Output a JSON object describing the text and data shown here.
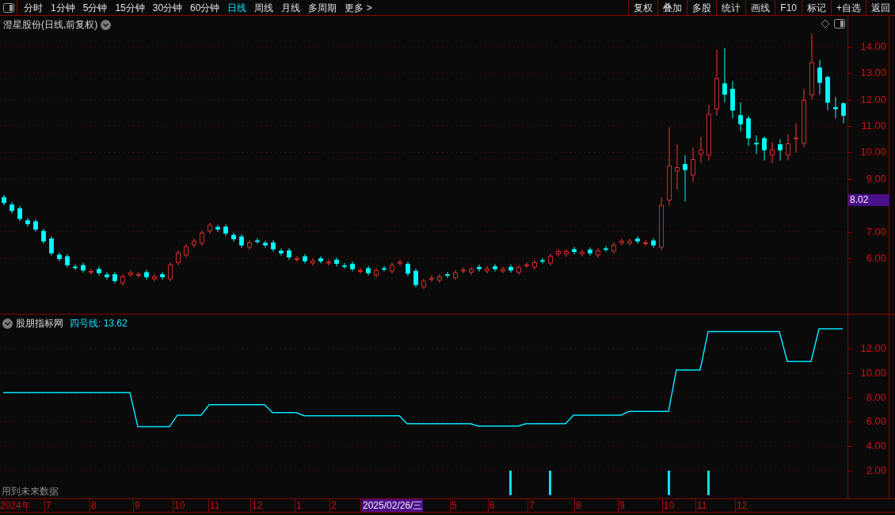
{
  "toolbar": {
    "periods": [
      {
        "label": "分时",
        "selected": false
      },
      {
        "label": "1分钟",
        "selected": false
      },
      {
        "label": "5分钟",
        "selected": false
      },
      {
        "label": "15分钟",
        "selected": false
      },
      {
        "label": "30分钟",
        "selected": false
      },
      {
        "label": "60分钟",
        "selected": false
      },
      {
        "label": "日线",
        "selected": true
      },
      {
        "label": "周线",
        "selected": false
      },
      {
        "label": "月线",
        "selected": false
      },
      {
        "label": "多周期",
        "selected": false
      },
      {
        "label": "更多 >",
        "selected": false
      }
    ],
    "actions": [
      "复权",
      "叠加",
      "多股",
      "统计",
      "画线",
      "F10",
      "标记",
      "+自选",
      "返回"
    ]
  },
  "main_chart": {
    "title": "澄星股份(日线,前复权)",
    "price_tag": "8.02",
    "chart_data": {
      "type": "candlestick",
      "grid": true,
      "ylim": [
        3.9,
        15.17
      ],
      "ohlc": [
        [
          8.3,
          8.4,
          8.0,
          8.1
        ],
        [
          8.02,
          8.12,
          7.7,
          7.8
        ],
        [
          7.88,
          7.98,
          7.4,
          7.5
        ],
        [
          7.42,
          7.52,
          7.2,
          7.3
        ],
        [
          7.38,
          7.48,
          7.0,
          7.1
        ],
        [
          7.02,
          7.12,
          6.55,
          6.65
        ],
        [
          6.73,
          6.83,
          6.1,
          6.2
        ],
        [
          6.12,
          6.22,
          5.88,
          5.98
        ],
        [
          6.06,
          6.16,
          5.65,
          5.75
        ],
        [
          5.67,
          5.77,
          5.55,
          5.65
        ],
        [
          5.73,
          5.83,
          5.45,
          5.55
        ],
        [
          5.47,
          5.6,
          5.37,
          5.5
        ],
        [
          5.58,
          5.68,
          5.35,
          5.45
        ],
        [
          5.37,
          5.47,
          5.2,
          5.3
        ],
        [
          5.38,
          5.48,
          5.05,
          5.15
        ],
        [
          5.07,
          5.4,
          4.97,
          5.3
        ],
        [
          5.38,
          5.55,
          5.28,
          5.45
        ],
        [
          5.37,
          5.48,
          5.27,
          5.38
        ],
        [
          5.46,
          5.56,
          5.2,
          5.3
        ],
        [
          5.22,
          5.4,
          5.12,
          5.3
        ],
        [
          5.38,
          5.48,
          5.2,
          5.3
        ],
        [
          5.22,
          5.85,
          5.12,
          5.75
        ],
        [
          5.83,
          6.3,
          5.73,
          6.2
        ],
        [
          6.12,
          6.53,
          6.02,
          6.43
        ],
        [
          6.51,
          6.75,
          6.41,
          6.65
        ],
        [
          6.57,
          7.05,
          6.47,
          6.95
        ],
        [
          7.03,
          7.35,
          6.93,
          7.25
        ],
        [
          7.17,
          7.27,
          7.0,
          7.1
        ],
        [
          7.18,
          7.28,
          6.85,
          6.95
        ],
        [
          6.87,
          6.97,
          6.63,
          6.73
        ],
        [
          6.81,
          6.91,
          6.4,
          6.5
        ],
        [
          6.42,
          6.68,
          6.32,
          6.58
        ],
        [
          6.66,
          6.76,
          6.55,
          6.65
        ],
        [
          6.57,
          6.67,
          6.4,
          6.5
        ],
        [
          6.58,
          6.68,
          6.25,
          6.35
        ],
        [
          6.27,
          6.37,
          6.1,
          6.2
        ],
        [
          6.28,
          6.38,
          5.95,
          6.05
        ],
        [
          5.97,
          6.08,
          5.87,
          5.98
        ],
        [
          6.06,
          6.16,
          5.8,
          5.9
        ],
        [
          5.82,
          6.0,
          5.72,
          5.9
        ],
        [
          5.98,
          6.08,
          5.8,
          5.9
        ],
        [
          5.82,
          5.95,
          5.72,
          5.85
        ],
        [
          5.93,
          6.03,
          5.7,
          5.8
        ],
        [
          5.72,
          5.82,
          5.6,
          5.7
        ],
        [
          5.78,
          5.88,
          5.5,
          5.6
        ],
        [
          5.52,
          5.63,
          5.42,
          5.53
        ],
        [
          5.61,
          5.71,
          5.35,
          5.45
        ],
        [
          5.37,
          5.63,
          5.27,
          5.53
        ],
        [
          5.61,
          5.71,
          5.5,
          5.6
        ],
        [
          5.52,
          5.83,
          5.42,
          5.73
        ],
        [
          5.81,
          5.95,
          5.71,
          5.85
        ],
        [
          5.77,
          5.87,
          5.33,
          5.43
        ],
        [
          5.51,
          5.61,
          4.9,
          5.0
        ],
        [
          4.92,
          5.23,
          4.82,
          5.13
        ],
        [
          5.21,
          5.35,
          5.11,
          5.25
        ],
        [
          5.17,
          5.4,
          5.07,
          5.3
        ],
        [
          5.38,
          5.48,
          5.25,
          5.35
        ],
        [
          5.27,
          5.55,
          5.17,
          5.45
        ],
        [
          5.53,
          5.65,
          5.43,
          5.55
        ],
        [
          5.47,
          5.68,
          5.37,
          5.58
        ],
        [
          5.66,
          5.76,
          5.5,
          5.6
        ],
        [
          5.52,
          5.7,
          5.42,
          5.6
        ],
        [
          5.68,
          5.78,
          5.5,
          5.6
        ],
        [
          5.52,
          5.68,
          5.42,
          5.58
        ],
        [
          5.66,
          5.76,
          5.45,
          5.55
        ],
        [
          5.47,
          5.75,
          5.37,
          5.65
        ],
        [
          5.73,
          5.85,
          5.63,
          5.75
        ],
        [
          5.67,
          5.93,
          5.57,
          5.83
        ],
        [
          5.91,
          6.01,
          5.8,
          5.9
        ],
        [
          5.82,
          6.18,
          5.72,
          6.08
        ],
        [
          6.16,
          6.35,
          6.06,
          6.25
        ],
        [
          6.17,
          6.35,
          6.07,
          6.25
        ],
        [
          6.33,
          6.43,
          6.15,
          6.25
        ],
        [
          6.17,
          6.33,
          6.07,
          6.23
        ],
        [
          6.31,
          6.41,
          6.1,
          6.2
        ],
        [
          6.12,
          6.38,
          6.02,
          6.28
        ],
        [
          6.36,
          6.46,
          6.25,
          6.35
        ],
        [
          6.27,
          6.6,
          6.17,
          6.5
        ],
        [
          6.58,
          6.75,
          6.48,
          6.65
        ],
        [
          6.57,
          6.75,
          6.47,
          6.65
        ],
        [
          6.73,
          6.83,
          6.55,
          6.65
        ],
        [
          6.57,
          6.68,
          6.47,
          6.58
        ],
        [
          6.66,
          6.76,
          6.4,
          6.5
        ],
        [
          6.42,
          8.3,
          6.3,
          8.0
        ],
        [
          8.2,
          10.95,
          8.0,
          9.5
        ],
        [
          9.3,
          10.3,
          8.6,
          9.43
        ],
        [
          9.55,
          9.9,
          8.15,
          9.35
        ],
        [
          9.15,
          10.2,
          8.9,
          9.73
        ],
        [
          9.93,
          10.6,
          9.6,
          10.1
        ],
        [
          9.9,
          11.8,
          9.7,
          11.45
        ],
        [
          11.65,
          13.9,
          11.4,
          12.8
        ],
        [
          12.6,
          13.95,
          11.9,
          12.2
        ],
        [
          12.4,
          12.7,
          11.3,
          11.6
        ],
        [
          11.4,
          11.9,
          10.8,
          11.08
        ],
        [
          11.28,
          11.4,
          10.25,
          10.55
        ],
        [
          10.35,
          10.65,
          9.95,
          10.33
        ],
        [
          10.53,
          10.6,
          9.7,
          10.1
        ],
        [
          9.9,
          10.4,
          9.6,
          10.1
        ],
        [
          10.3,
          10.5,
          9.7,
          10.1
        ],
        [
          9.9,
          10.7,
          9.7,
          10.33
        ],
        [
          10.53,
          11.1,
          10.0,
          10.55
        ],
        [
          10.35,
          12.4,
          10.2,
          11.98
        ],
        [
          12.18,
          14.5,
          12.0,
          13.4
        ],
        [
          13.2,
          13.5,
          12.2,
          12.65
        ],
        [
          12.85,
          12.9,
          11.6,
          11.9
        ],
        [
          11.7,
          12.1,
          11.3,
          11.65
        ],
        [
          11.85,
          11.9,
          11.1,
          11.4
        ]
      ],
      "yticks": [
        {
          "value": 6,
          "label": "6.00"
        },
        {
          "value": 7,
          "label": "7.00"
        },
        {
          "value": 9,
          "label": "9.00"
        },
        {
          "value": 10,
          "label": "10.00"
        },
        {
          "value": 11,
          "label": "11.00"
        },
        {
          "value": 12,
          "label": "12.00"
        },
        {
          "value": 13,
          "label": "13.00"
        },
        {
          "value": 14,
          "label": "14.00"
        }
      ]
    }
  },
  "indicator": {
    "name": "股朋指标网",
    "line_value": ": 13.62",
    "note": "用到未来数据",
    "chart_data": {
      "type": "line",
      "grid": true,
      "ylim": [
        -0.27,
        14.79
      ],
      "series": [
        {
          "name": "四号线",
          "color": "#00e5ff",
          "values": [
            8.4,
            8.4,
            8.4,
            8.4,
            8.4,
            8.4,
            8.4,
            8.4,
            8.4,
            8.4,
            8.4,
            8.4,
            8.4,
            8.4,
            8.4,
            8.4,
            8.4,
            5.6,
            5.6,
            5.6,
            5.6,
            5.6,
            6.55,
            6.55,
            6.55,
            6.55,
            7.4,
            7.4,
            7.4,
            7.4,
            7.4,
            7.4,
            7.4,
            7.4,
            6.75,
            6.75,
            6.75,
            6.75,
            6.5,
            6.5,
            6.5,
            6.5,
            6.5,
            6.5,
            6.5,
            6.5,
            6.5,
            6.5,
            6.5,
            6.5,
            6.5,
            5.85,
            5.85,
            5.85,
            5.85,
            5.85,
            5.85,
            5.85,
            5.85,
            5.85,
            5.65,
            5.65,
            5.65,
            5.65,
            5.65,
            5.65,
            5.85,
            5.85,
            5.85,
            5.85,
            5.85,
            5.85,
            6.55,
            6.55,
            6.55,
            6.55,
            6.55,
            6.55,
            6.55,
            6.85,
            6.85,
            6.85,
            6.85,
            6.85,
            6.85,
            10.25,
            10.25,
            10.25,
            10.25,
            13.4,
            13.4,
            13.4,
            13.4,
            13.4,
            13.4,
            13.4,
            13.4,
            13.4,
            13.4,
            10.95,
            10.95,
            10.95,
            10.95,
            13.62,
            13.62,
            13.62,
            13.62
          ]
        },
        {
          "type": "bar",
          "color": "#00e5ff",
          "values": [
            null,
            null,
            null,
            null,
            null,
            null,
            null,
            null,
            null,
            null,
            null,
            null,
            null,
            null,
            null,
            null,
            null,
            null,
            null,
            null,
            null,
            null,
            null,
            null,
            null,
            null,
            null,
            null,
            null,
            null,
            null,
            null,
            null,
            null,
            null,
            null,
            null,
            null,
            null,
            null,
            null,
            null,
            null,
            null,
            null,
            null,
            null,
            null,
            null,
            null,
            null,
            null,
            null,
            null,
            null,
            null,
            null,
            null,
            null,
            null,
            null,
            null,
            null,
            null,
            2,
            null,
            null,
            null,
            null,
            2,
            null,
            null,
            null,
            null,
            null,
            null,
            null,
            null,
            null,
            null,
            null,
            null,
            null,
            null,
            2,
            null,
            null,
            null,
            null,
            2,
            null,
            null,
            null,
            null,
            null,
            null,
            null,
            null,
            null,
            null,
            null,
            null,
            null,
            null,
            null,
            null,
            null
          ]
        }
      ],
      "yticks": [
        {
          "value": 2,
          "label": "2.00"
        },
        {
          "value": 4,
          "label": "4.00"
        },
        {
          "value": 6,
          "label": "6.00"
        },
        {
          "value": 8,
          "label": "8.00"
        },
        {
          "value": 10,
          "label": "10.00"
        },
        {
          "value": 12,
          "label": "12.00"
        }
      ]
    }
  },
  "date_axis": [
    {
      "label": "2024年",
      "selected": false
    },
    {
      "label": "7",
      "selected": false
    },
    {
      "label": "8",
      "selected": false
    },
    {
      "label": "9",
      "selected": false
    },
    {
      "label": "10",
      "selected": false
    },
    {
      "label": "11",
      "selected": false
    },
    {
      "label": "12",
      "selected": false
    },
    {
      "label": "1",
      "selected": false
    },
    {
      "label": "2",
      "selected": false
    },
    {
      "label": "2025/02/26/三",
      "selected": true
    },
    {
      "label": "5",
      "selected": false
    },
    {
      "label": "6",
      "selected": false
    },
    {
      "label": "7",
      "selected": false
    },
    {
      "label": "8",
      "selected": false
    },
    {
      "label": "9",
      "selected": false
    },
    {
      "label": "10",
      "selected": false
    },
    {
      "label": "11",
      "selected": false
    },
    {
      "label": "12",
      "selected": false
    }
  ]
}
